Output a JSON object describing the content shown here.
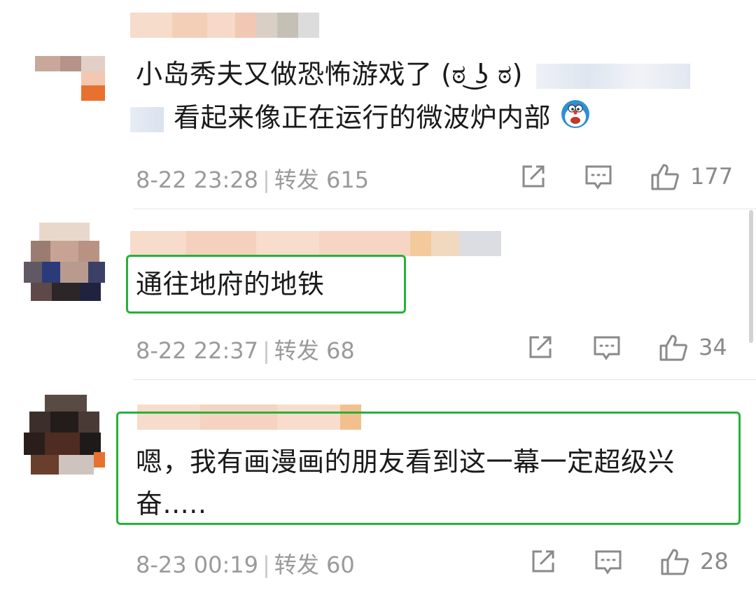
{
  "comments": [
    {
      "text_line1": "小岛秀夫又做恐怖游戏了 (ಠ ͜ʖ ಠ)",
      "text_line2": "看起来像正在运行的微波炉内部",
      "emoji": "doraemon-icon",
      "time": "8-22 23:28",
      "separator": "|",
      "repost_label": "转发",
      "repost_count": "615",
      "likes": "177"
    },
    {
      "text": "通往地府的地铁",
      "time": "8-22 22:37",
      "separator": "|",
      "repost_label": "转发",
      "repost_count": "68",
      "likes": "34",
      "highlighted": true
    },
    {
      "text_line1": "嗯，我有画漫画的朋友看到这一幕一定超级兴",
      "text_line2": "奋.....",
      "time": "8-23 00:19",
      "separator": "|",
      "repost_label": "转发",
      "repost_count": "60",
      "likes": "28",
      "highlighted": true
    }
  ],
  "icons": [
    "share-icon",
    "comment-icon",
    "thumbs-up-icon"
  ],
  "colors": {
    "highlight": "#28b03a",
    "meta_text": "#9a9a9a",
    "body_text": "#1a1a1a"
  }
}
